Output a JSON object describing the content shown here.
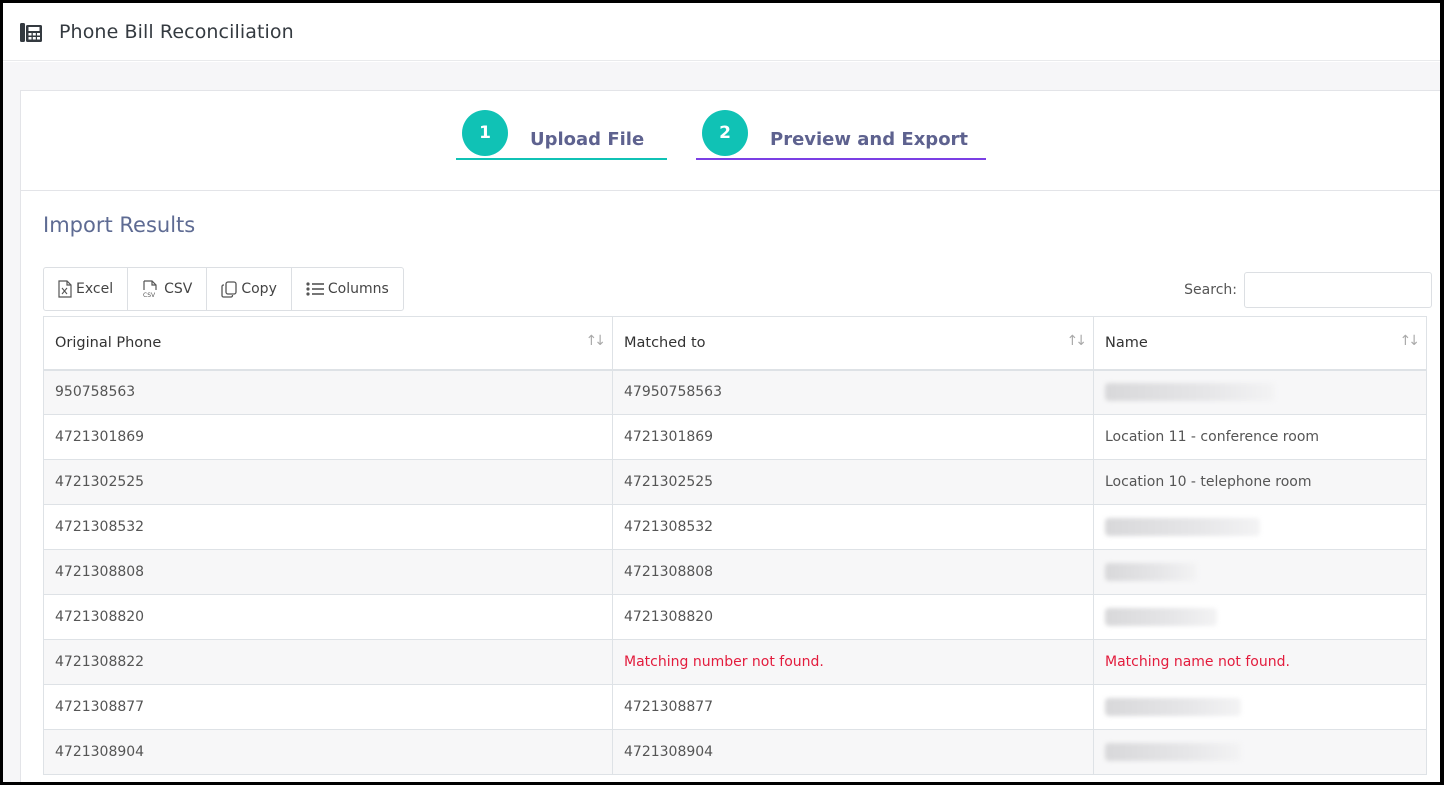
{
  "app": {
    "title": "Phone Bill Reconciliation",
    "icon": "building-phone-icon"
  },
  "wizard": {
    "steps": [
      {
        "number": "1",
        "label": "Upload File",
        "accent": "#10c2b5"
      },
      {
        "number": "2",
        "label": "Preview and Export",
        "accent": "#7b3fe4"
      }
    ]
  },
  "section": {
    "title": "Import Results"
  },
  "toolbar": {
    "excel_label": "Excel",
    "csv_label": "CSV",
    "copy_label": "Copy",
    "columns_label": "Columns"
  },
  "search": {
    "label": "Search:",
    "value": ""
  },
  "table": {
    "headers": [
      "Original Phone",
      "Matched to",
      "Name"
    ],
    "sort_glyph": "↑↓",
    "rows": [
      {
        "original": "950758563",
        "matched": "47950758563",
        "name": "",
        "redacted": true,
        "blur_width": 170
      },
      {
        "original": "4721301869",
        "matched": "4721301869",
        "name": "Location 11 - conference room",
        "redacted": false
      },
      {
        "original": "4721302525",
        "matched": "4721302525",
        "name": "Location 10 - telephone room",
        "redacted": false
      },
      {
        "original": "4721308532",
        "matched": "4721308532",
        "name": "",
        "redacted": true,
        "blur_width": 155
      },
      {
        "original": "4721308808",
        "matched": "4721308808",
        "name": "",
        "redacted": true,
        "blur_width": 92
      },
      {
        "original": "4721308820",
        "matched": "4721308820",
        "name": "",
        "redacted": true,
        "blur_width": 112
      },
      {
        "original": "4721308822",
        "matched": "Matching number not found.",
        "name": "Matching name not found.",
        "redacted": false,
        "error": true
      },
      {
        "original": "4721308877",
        "matched": "4721308877",
        "name": "",
        "redacted": true,
        "blur_width": 136
      },
      {
        "original": "4721308904",
        "matched": "4721308904",
        "name": "",
        "redacted": true,
        "blur_width": 136
      }
    ]
  },
  "colors": {
    "error": "#e31c3d",
    "step_number_bg": "#10c2b5",
    "step_label": "#5e628f"
  }
}
